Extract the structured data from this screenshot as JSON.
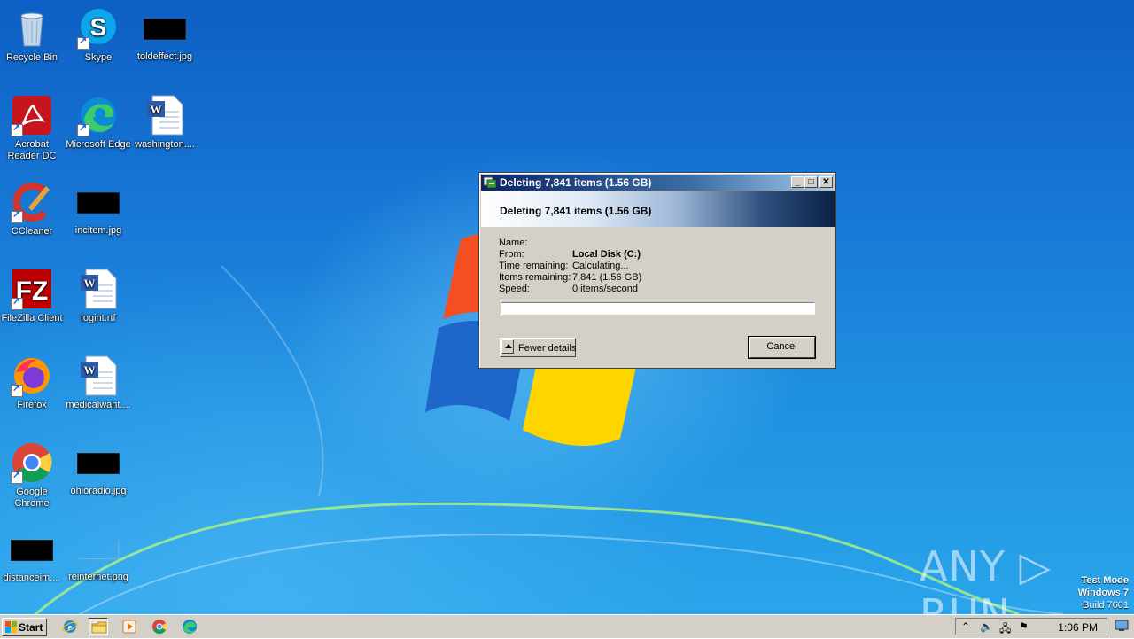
{
  "desktop_icons": [
    {
      "id": "recycle",
      "label": "Recycle Bin",
      "icon": "recycle-bin-icon"
    },
    {
      "id": "skype",
      "label": "Skype",
      "icon": "skype-icon"
    },
    {
      "id": "toldeffect",
      "label": "toldeffect.jpg",
      "icon": "image-file-icon"
    },
    {
      "id": "acrobat",
      "label": "Acrobat Reader DC",
      "icon": "acrobat-icon"
    },
    {
      "id": "edge",
      "label": "Microsoft Edge",
      "icon": "edge-icon"
    },
    {
      "id": "washington",
      "label": "washington....",
      "icon": "word-doc-icon"
    },
    {
      "id": "ccleaner",
      "label": "CCleaner",
      "icon": "ccleaner-icon"
    },
    {
      "id": "incitem",
      "label": "incitem.jpg",
      "icon": "image-file-icon"
    },
    {
      "id": "filezilla",
      "label": "FileZilla Client",
      "icon": "filezilla-icon"
    },
    {
      "id": "logint",
      "label": "logint.rtf",
      "icon": "word-doc-icon"
    },
    {
      "id": "firefox",
      "label": "Firefox",
      "icon": "firefox-icon"
    },
    {
      "id": "medicalwant",
      "label": "medicalwant....",
      "icon": "word-doc-icon"
    },
    {
      "id": "chrome",
      "label": "Google Chrome",
      "icon": "chrome-icon"
    },
    {
      "id": "ohioradio",
      "label": "ohioradio.jpg",
      "icon": "image-file-icon"
    },
    {
      "id": "distanceim",
      "label": "distanceim....",
      "icon": "image-file-icon"
    },
    {
      "id": "reinternet",
      "label": "reinternet.png",
      "icon": "image-file-icon"
    }
  ],
  "dialog": {
    "title": "Deleting 7,841 items (1.56 GB)",
    "heading": "Deleting 7,841 items (1.56 GB)",
    "fields": [
      {
        "label": "Name:",
        "value": ""
      },
      {
        "label": "From:",
        "value": "Local Disk (C:)"
      },
      {
        "label": "Time remaining:",
        "value": "Calculating..."
      },
      {
        "label": "Items remaining:",
        "value": "7,841 (1.56 GB)"
      },
      {
        "label": "Speed:",
        "value": "0 items/second"
      }
    ],
    "progress": 0,
    "fewer_details_label": "Fewer details",
    "cancel_label": "Cancel"
  },
  "watermark": "ANY ▷ RUN",
  "os_info": {
    "line1": "Test Mode",
    "line2": "Windows 7",
    "line3": "Build 7601"
  },
  "taskbar": {
    "start_label": "Start",
    "pinned": [
      "internet-explorer-icon",
      "file-explorer-icon",
      "media-player-icon",
      "chrome-icon",
      "edge-icon"
    ],
    "clock": "1:06 PM"
  }
}
